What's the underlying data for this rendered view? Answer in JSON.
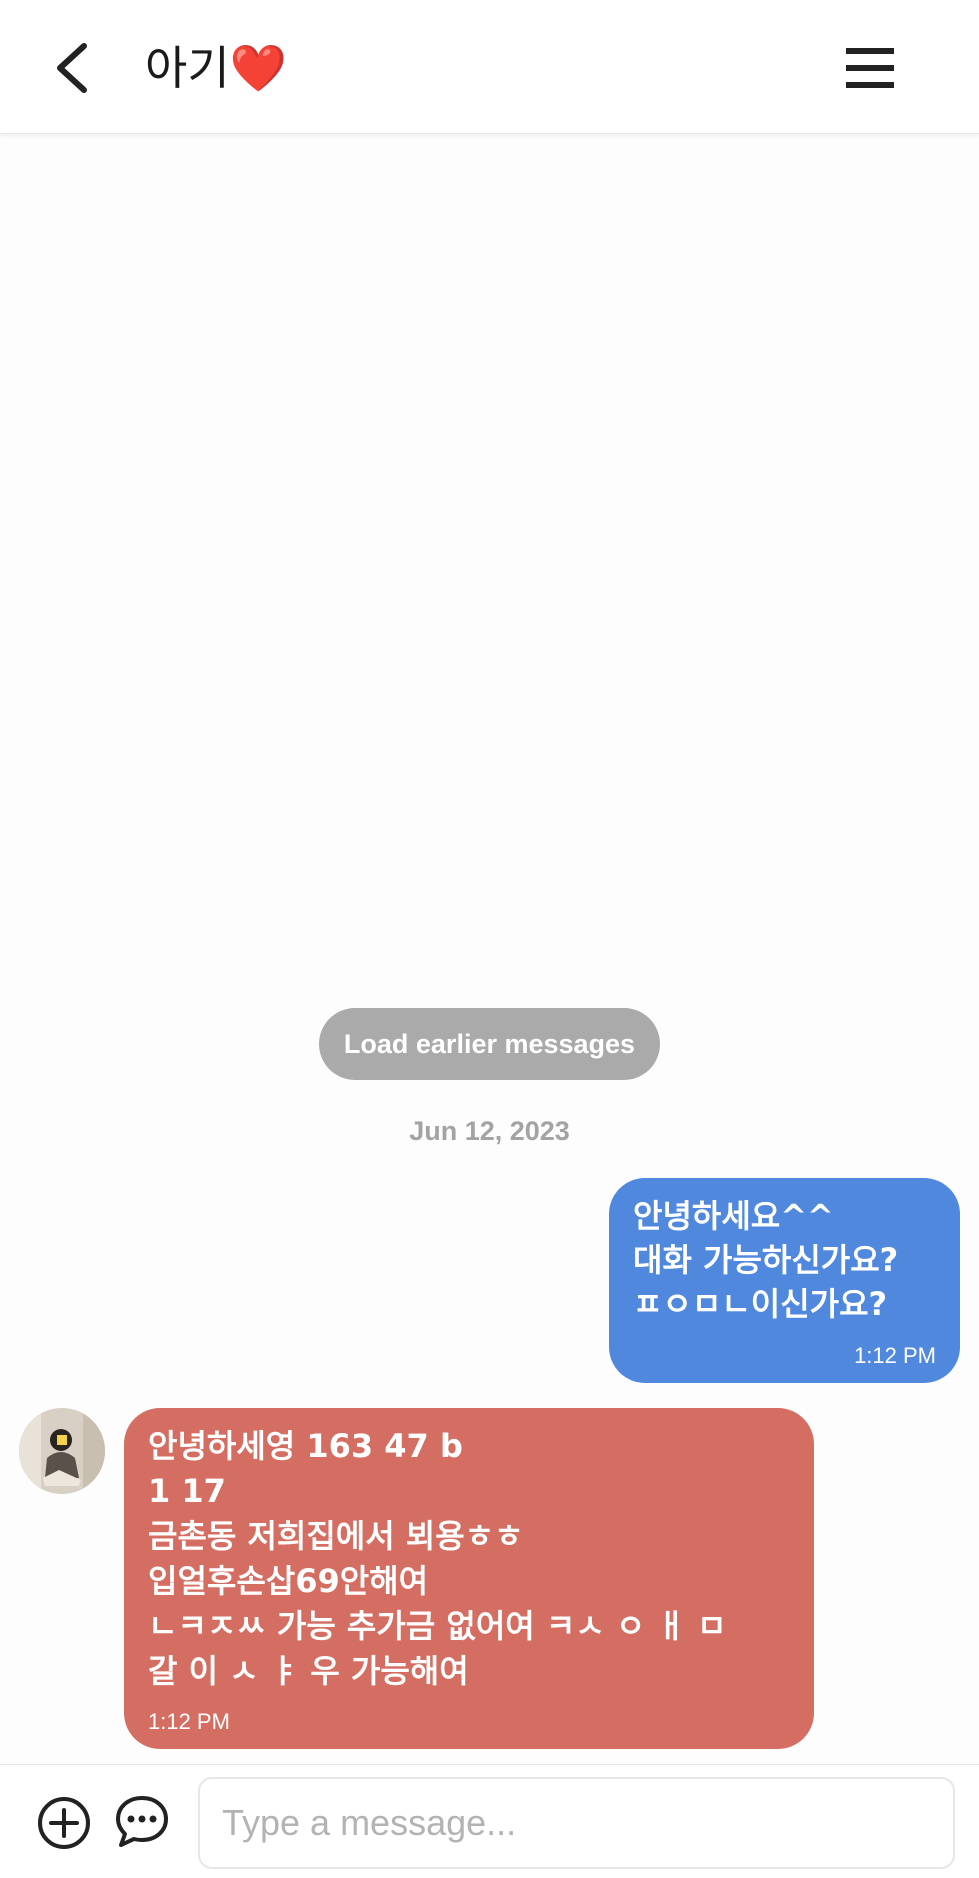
{
  "header": {
    "title": "아기❤️",
    "back_icon": "chevron-left-icon",
    "menu_icon": "hamburger-menu-icon"
  },
  "load_earlier_label": "Load earlier messages",
  "date_separator": "Jun 12, 2023",
  "messages": [
    {
      "direction": "outgoing",
      "text": "안녕하세요^^\n대화 가능하신가요?\nㅍㅇㅁㄴ이신가요?",
      "time": "1:12 PM",
      "color": "#5088dd"
    },
    {
      "direction": "incoming",
      "text": "안녕하세영 163 47 b\n1 17\n금촌동 저희집에서 뵈용ㅎㅎ\n입얼후손삽69안해여\nㄴㅋㅈㅆ 가능 추가금 없어여 ㅋㅅ ㅇ ㅐ ㅁ\n갈 이 ㅅ ㅑ 우 가능해여",
      "time": "1:12 PM",
      "color": "#d46e62"
    }
  ],
  "composer": {
    "placeholder": "Type a message...",
    "value": "",
    "add_icon": "plus-circle-icon",
    "chat_icon": "chat-bubble-icon"
  }
}
